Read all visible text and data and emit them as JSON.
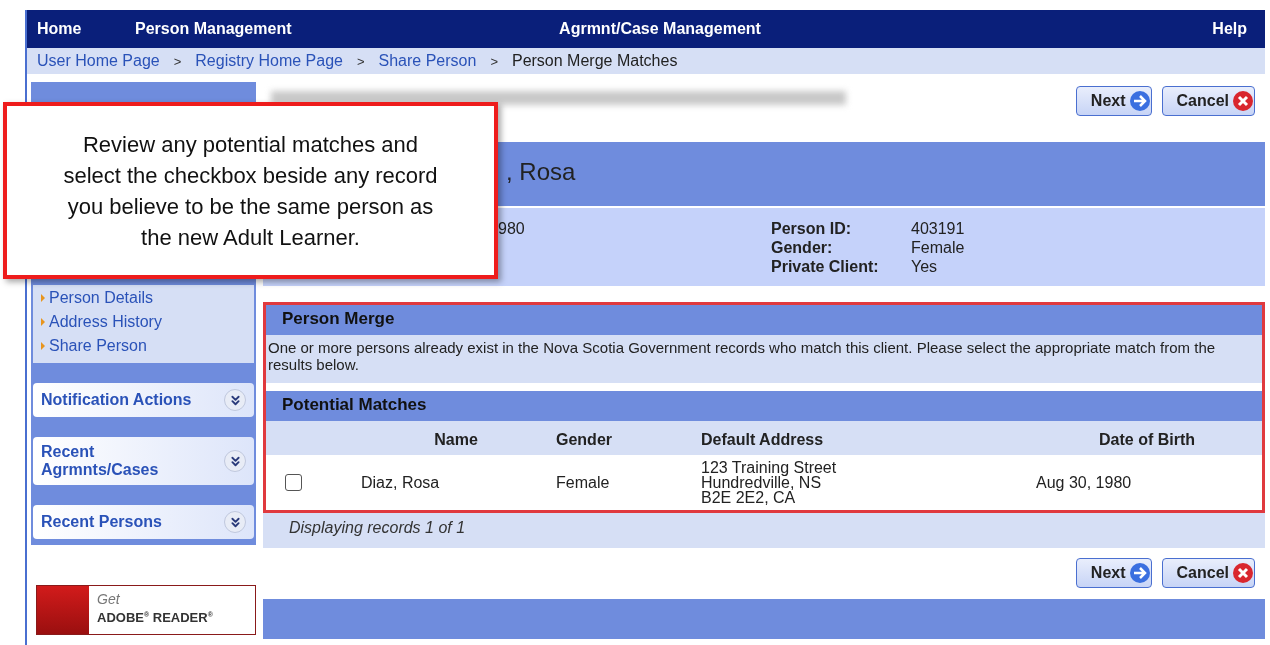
{
  "nav": [
    {
      "label": "Home"
    },
    {
      "label": "Person Management"
    },
    {
      "label": "Agrmnt/Case Management"
    },
    {
      "label": "Help"
    }
  ],
  "breadcrumb": [
    {
      "label": "User Home Page",
      "link": true
    },
    {
      "separator": ">",
      "label": "Registry Home Page",
      "link": true
    },
    {
      "separator": ">",
      "label": "Share Person",
      "link": true
    },
    {
      "separator": ">",
      "label": "Person Merge Matches",
      "link": false
    }
  ],
  "sidebar": {
    "links": [
      "Person Details",
      "Address History",
      "Share Person"
    ],
    "panels": [
      "Notification Actions",
      "Recent Agrmnts/Cases",
      "Recent Persons"
    ],
    "adobe": {
      "line1": "Get",
      "line2": "ADOBE$^{®}$ READER$^{®}$"
    }
  },
  "top_buttons": [
    {
      "label": "Next",
      "kind": "next"
    },
    {
      "label": "Cancel",
      "kind": "cancel"
    }
  ],
  "person": {
    "name": ", Rosa",
    "fragment": "980",
    "fields": [
      {
        "label": "Person ID:",
        "value": "403191"
      },
      {
        "label": "Gender:",
        "value": "Female"
      },
      {
        "label": "Private Client:",
        "value": "Yes"
      }
    ]
  },
  "merge": {
    "title": "Person Merge",
    "message": "One or more persons already exist in the Nova Scotia Government records who match this client. Please select the appropriate match from the results below.",
    "matches_title": "Potential Matches",
    "columns": [
      "Name",
      "Gender",
      "Default Address",
      "Date of Birth"
    ],
    "rows": [
      {
        "selected": false,
        "name": "Diaz, Rosa",
        "gender": "Female",
        "address": [
          "123 Training Street",
          "Hundredville, NS",
          "B2E 2E2, CA"
        ],
        "dob": "Aug 30, 1980"
      }
    ],
    "footer": "Displaying records 1 of 1"
  },
  "bottom_buttons": [
    {
      "label": "Next",
      "kind": "next"
    },
    {
      "label": "Cancel",
      "kind": "cancel"
    }
  ],
  "callout": "Review any potential matches and select the checkbox beside any record you believe to be the same person as the new Adult Learner."
}
